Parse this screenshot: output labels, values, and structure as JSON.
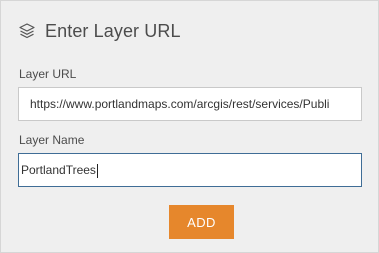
{
  "header": {
    "icon": "layers-icon",
    "title": "Enter Layer URL"
  },
  "layer_url": {
    "label": "Layer URL",
    "value": "https://www.portlandmaps.com/arcgis/rest/services/Publi"
  },
  "layer_name": {
    "label": "Layer Name",
    "value": "PortlandTrees"
  },
  "add_button": {
    "label": "ADD"
  },
  "colors": {
    "panel_bg": "#efefef",
    "accent": "#e6872c",
    "focus_border": "#3f6d96",
    "text": "#4c4c4c"
  }
}
